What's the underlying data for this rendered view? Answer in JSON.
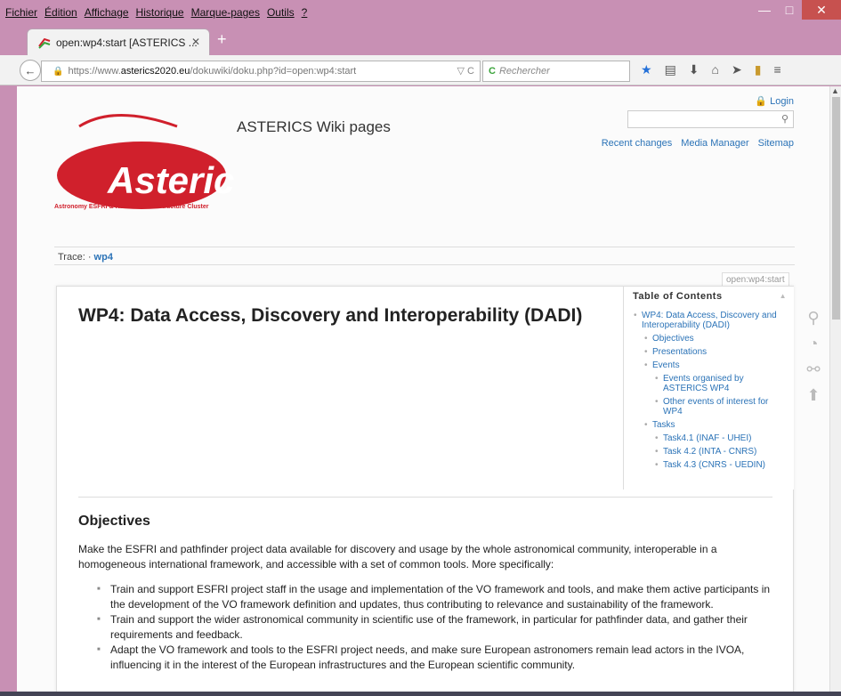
{
  "menubar": {
    "items": [
      "Fichier",
      "Édition",
      "Affichage",
      "Historique",
      "Marque-pages",
      "Outils",
      "?"
    ]
  },
  "window_controls": {
    "minimize": "—",
    "maximize": "□",
    "close": "✕"
  },
  "tab": {
    "title": "open:wp4:start [ASTERICS ...",
    "close": "✕",
    "new_tab": "+"
  },
  "navbar": {
    "back": "←",
    "url_prefix": "https://www.",
    "url_domain": "asterics2020.eu",
    "url_rest": "/dokuwiki/doku.php?id=open:wp4:start",
    "url_tools": "▽ C",
    "search_placeholder": "Rechercher",
    "icons": [
      "star-icon",
      "reading-list-icon",
      "download-icon",
      "home-icon",
      "send-icon",
      "pocket-icon",
      "menu-icon"
    ]
  },
  "site": {
    "title": "ASTERICS Wiki pages",
    "logo_text": "Asterics",
    "logo_tagline": "Astronomy ESFRI & Research Infrastructure Cluster",
    "login": "Login",
    "links": [
      "Recent changes",
      "Media Manager",
      "Sitemap"
    ],
    "trace_label": "Trace:",
    "trace_link": "wp4",
    "page_id": "open:wp4:start"
  },
  "page": {
    "title": "WP4: Data Access, Discovery and Interoperability (DADI)",
    "toc": {
      "heading": "Table of Contents",
      "items": [
        {
          "label": "WP4: Data Access, Discovery and Interoperability (DADI)",
          "level": 1
        },
        {
          "label": "Objectives",
          "level": 2
        },
        {
          "label": "Presentations",
          "level": 2
        },
        {
          "label": "Events",
          "level": 2
        },
        {
          "label": "Events organised by ASTERICS WP4",
          "level": 3
        },
        {
          "label": "Other events of interest for WP4",
          "level": 3
        },
        {
          "label": "Tasks",
          "level": 2
        },
        {
          "label": "Task4.1 (INAF - UHEI)",
          "level": 3
        },
        {
          "label": "Task 4.2 (INTA - CNRS)",
          "level": 3
        },
        {
          "label": "Task 4.3 (CNRS - UEDIN)",
          "level": 3
        }
      ]
    },
    "section_title": "Objectives",
    "intro": "Make the ESFRI and pathfinder project data available for discovery and usage by the whole astronomical community, interoperable in a homogeneous international framework, and accessible with a set of common tools. More specifically:",
    "bullets": [
      "Train and support ESFRI project staff in the usage and implementation of the VO framework and tools, and make them active participants in the development of the VO framework definition and updates, thus contributing to relevance and sustainability of the framework.",
      "Train and support the wider astronomical community in scientific use of the framework, in particular for pathfinder data, and gather their requirements and feedback.",
      "Adapt the VO framework and tools to the ESFRI project needs, and make sure European astronomers remain lead actors in the IVOA, influencing it in the interest of the European infrastructures and the European scientific community."
    ]
  },
  "colors": {
    "window_frame": "#c890b4",
    "link": "#2b73b7",
    "logo_red": "#d0202c",
    "close_button": "#c7514f"
  }
}
